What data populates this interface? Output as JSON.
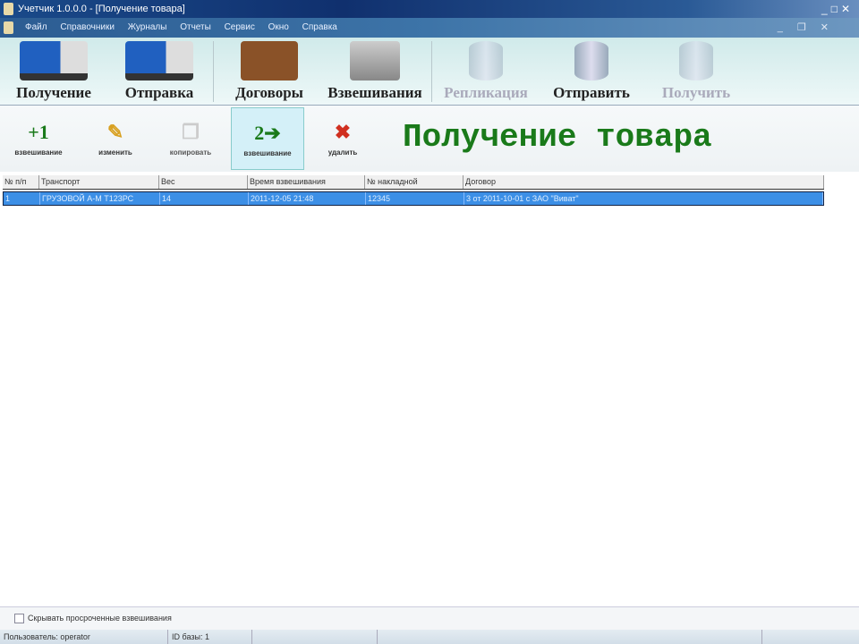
{
  "window": {
    "title": "Учетчик 1.0.0.0 - [Получение товара]"
  },
  "menu": [
    "Файл",
    "Справочники",
    "Журналы",
    "Отчеты",
    "Сервис",
    "Окно",
    "Справка"
  ],
  "main_toolbar": [
    {
      "label": "Получение",
      "icon": "truck-in-icon",
      "enabled": true
    },
    {
      "label": "Отправка",
      "icon": "truck-out-icon",
      "enabled": true
    },
    {
      "label": "Договоры",
      "icon": "briefcase-icon",
      "enabled": true
    },
    {
      "label": "Взвешивания",
      "icon": "scale-icon",
      "enabled": true
    },
    {
      "label": "Репликация",
      "icon": "database-replication-icon",
      "enabled": false
    },
    {
      "label": "Отправить",
      "icon": "database-send-icon",
      "enabled": true
    },
    {
      "label": "Получить",
      "icon": "database-receive-icon",
      "enabled": false
    }
  ],
  "action_toolbar": [
    {
      "label": "взвешивание",
      "glyph": "+1"
    },
    {
      "label": "изменить",
      "glyph": "✎"
    },
    {
      "label": "копировать",
      "glyph": "❐"
    },
    {
      "label": "взвешивание",
      "glyph": "2➔"
    },
    {
      "label": "удалить",
      "glyph": "✖"
    }
  ],
  "page_title": "Получение товара",
  "table": {
    "columns": [
      "№ п/п",
      "Транспорт",
      "Вес",
      "Время взвешивания",
      "№ накладной",
      "Договор"
    ],
    "rows": [
      [
        "1",
        "ГРУЗОВОЙ А-М Т123РС",
        "14",
        "2011-12-05 21:48",
        "12345",
        "3 от 2011-10-01 с ЗАО \"Виват\""
      ]
    ]
  },
  "footer": {
    "checkbox_label": "Скрывать просроченные взвешивания",
    "checked": false
  },
  "status": {
    "user": "Пользователь: operator",
    "db_id": "ID базы: 1"
  }
}
